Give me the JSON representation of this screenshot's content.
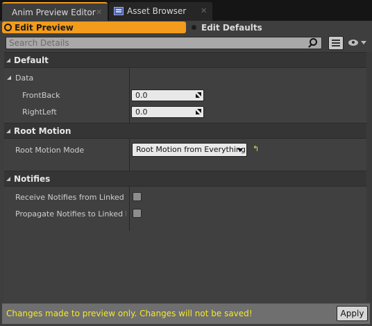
{
  "tabs": [
    {
      "label": "Anim Preview Editor",
      "active": true
    },
    {
      "label": "Asset Browser",
      "active": false
    }
  ],
  "modes": {
    "edit_preview": "Edit Preview",
    "edit_defaults": "Edit Defaults",
    "selected": "Edit Preview"
  },
  "search": {
    "placeholder": "Search Details",
    "value": ""
  },
  "categories": {
    "default": {
      "label": "Default",
      "subcategory": "Data",
      "props": [
        {
          "label": "FrontBack",
          "value": "0.0"
        },
        {
          "label": "RightLeft",
          "value": "0.0"
        }
      ]
    },
    "root_motion": {
      "label": "Root Motion",
      "props": [
        {
          "label": "Root Motion Mode",
          "value": "Root Motion from Everything"
        }
      ]
    },
    "notifies": {
      "label": "Notifies",
      "props": [
        {
          "label": "Receive Notifies from Linked Instances",
          "checked": false
        },
        {
          "label": "Propagate Notifies to Linked Instances",
          "checked": false
        }
      ]
    }
  },
  "footer": {
    "message": "Changes made to preview only. Changes will not be saved!",
    "apply_label": "Apply"
  },
  "colors": {
    "accent": "#f29b1c",
    "warning_text": "#f5e82a",
    "panel": "#3e3e3e"
  }
}
